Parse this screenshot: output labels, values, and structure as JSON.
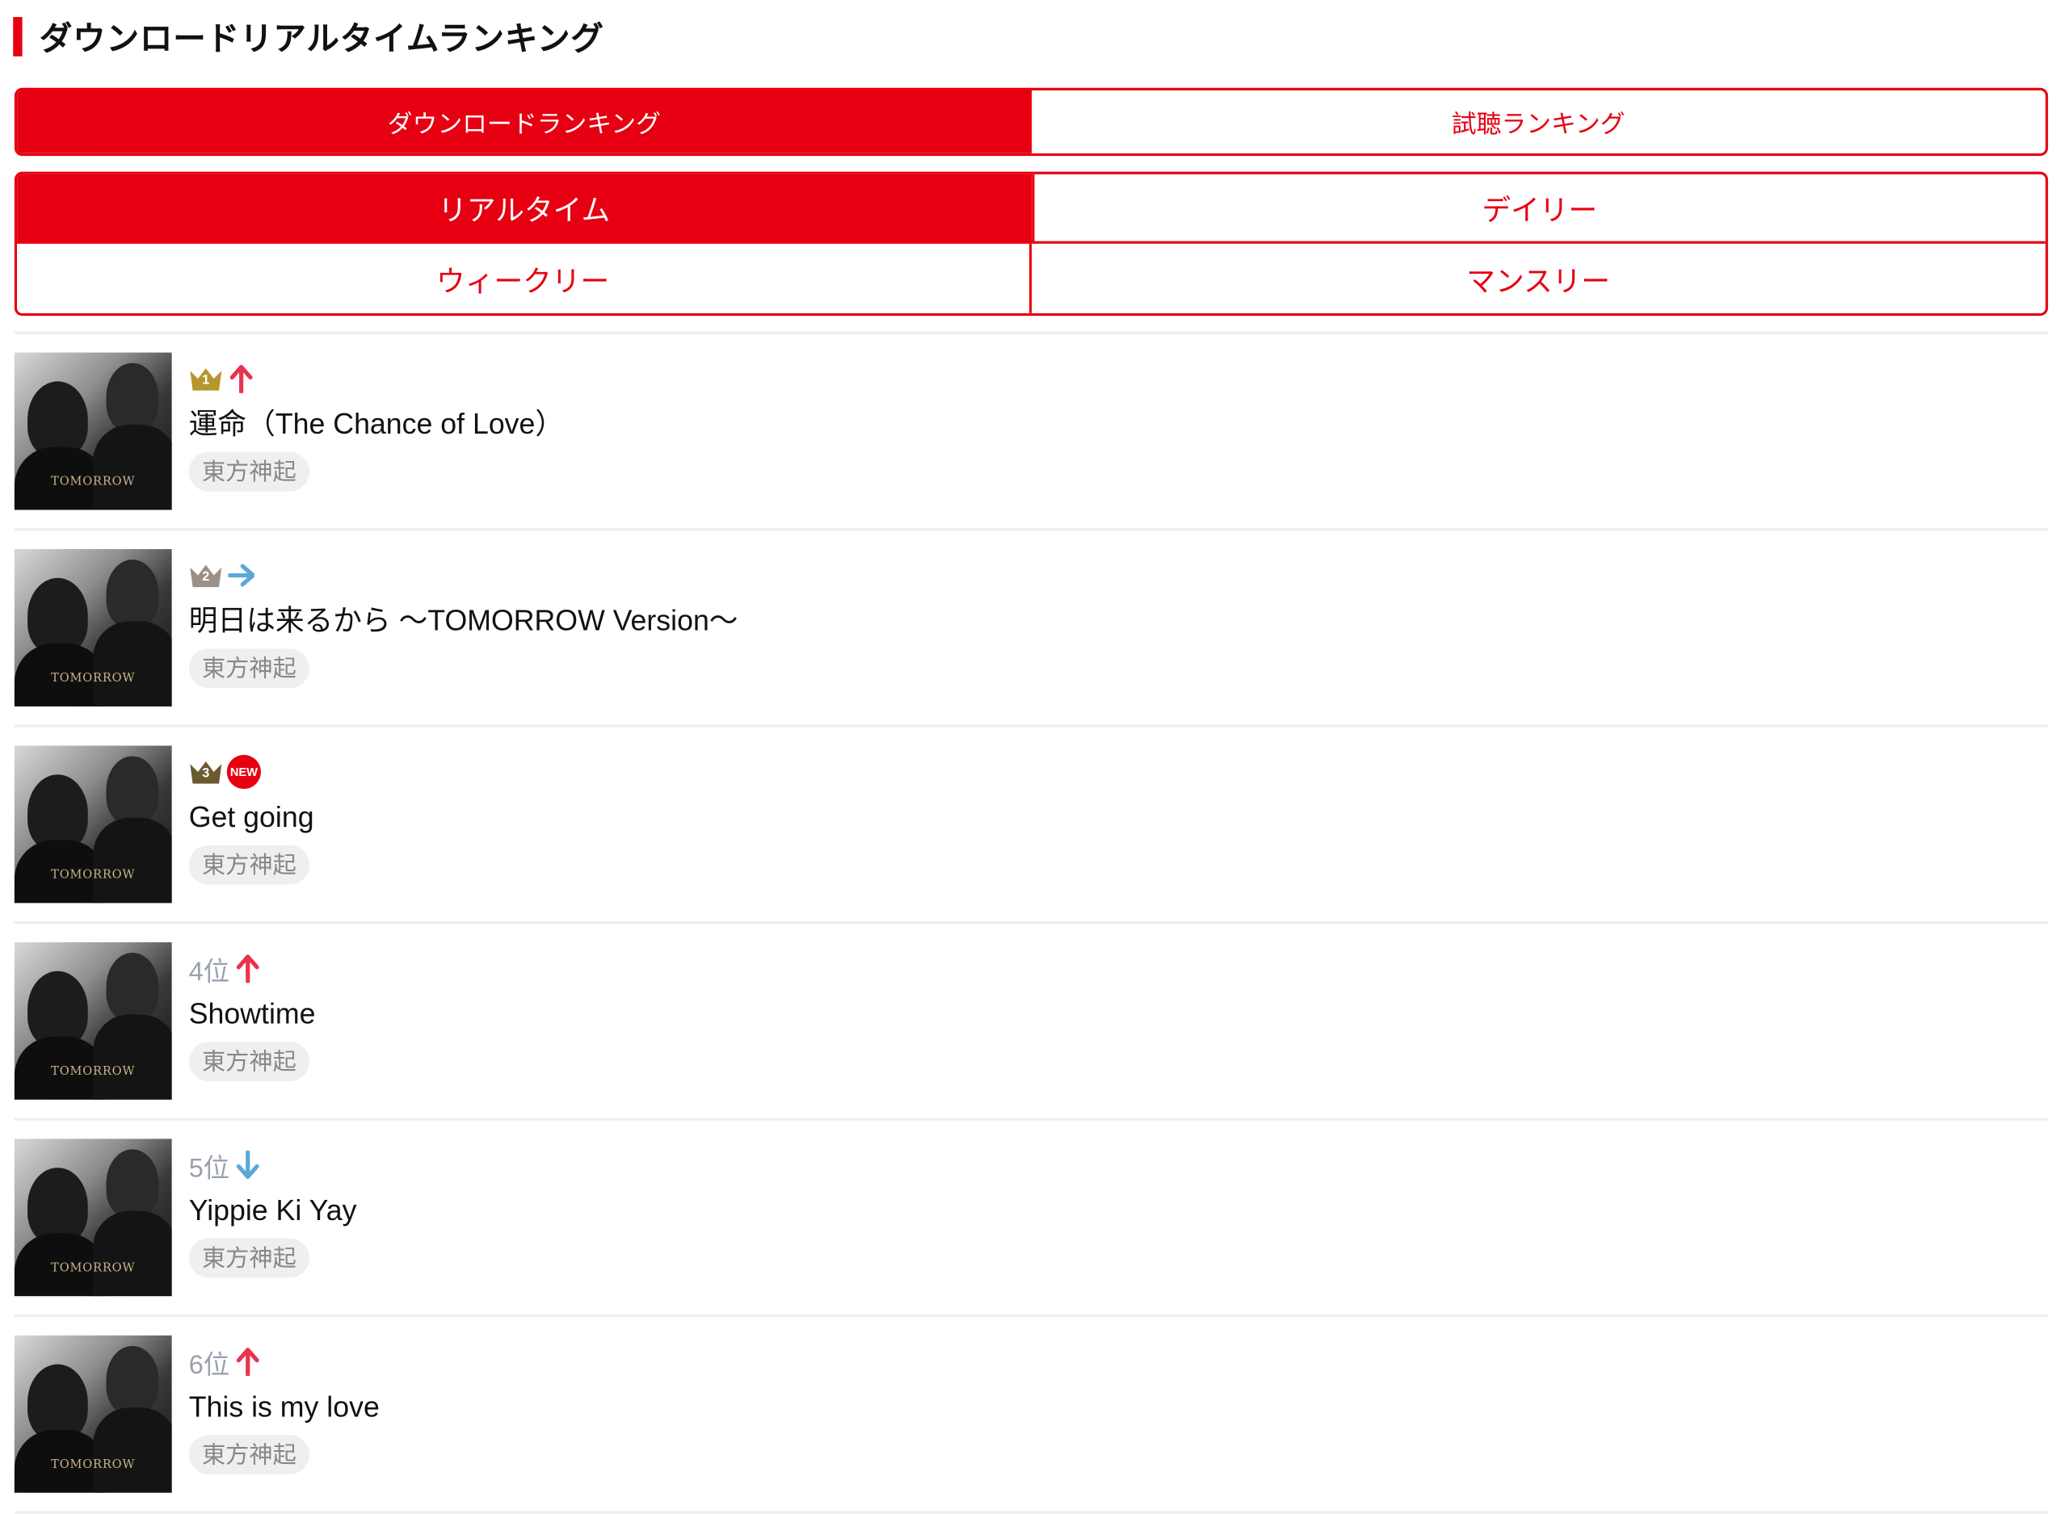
{
  "heading": {
    "title": "ダウンロードリアルタイムランキング"
  },
  "tabs_type": [
    {
      "label": "ダウンロードランキング",
      "active": true
    },
    {
      "label": "試聴ランキング",
      "active": false
    }
  ],
  "tabs_period": [
    {
      "label": "リアルタイム",
      "active": true
    },
    {
      "label": "デイリー",
      "active": false
    },
    {
      "label": "ウィークリー",
      "active": false
    },
    {
      "label": "マンスリー",
      "active": false
    }
  ],
  "colors": {
    "accent": "#e60012",
    "gold": "#b7962d",
    "silver": "#9a9088",
    "bronze": "#6b5a2e",
    "up": "#e8344e",
    "flat": "#5aa9d6",
    "down": "#5aa9d6"
  },
  "album_logo": "TOMORROW",
  "ranking": [
    {
      "rank_label": "1",
      "rank_suffix": "",
      "crown": "gold",
      "movement": "up",
      "title": "運命（The Chance of Love）",
      "artist": "東方神起"
    },
    {
      "rank_label": "2",
      "rank_suffix": "",
      "crown": "silver",
      "movement": "same",
      "title": "明日は来るから ～TOMORROW Version～",
      "artist": "東方神起"
    },
    {
      "rank_label": "3",
      "rank_suffix": "",
      "crown": "bronze",
      "movement": "new",
      "new_label": "NEW",
      "title": "Get going",
      "artist": "東方神起"
    },
    {
      "rank_label": "4位",
      "crown": "none",
      "movement": "up",
      "title": "Showtime",
      "artist": "東方神起"
    },
    {
      "rank_label": "5位",
      "crown": "none",
      "movement": "down",
      "title": "Yippie Ki Yay",
      "artist": "東方神起"
    },
    {
      "rank_label": "6位",
      "crown": "none",
      "movement": "up",
      "title": "This is my love",
      "artist": "東方神起"
    }
  ]
}
